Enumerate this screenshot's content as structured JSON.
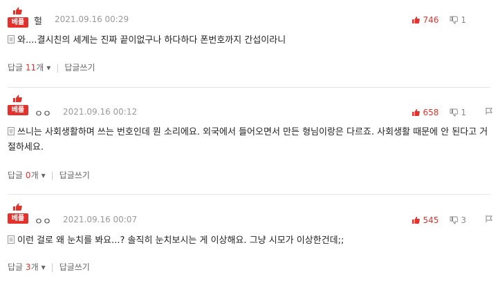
{
  "badge_label": "베플",
  "comments": [
    {
      "nickname": "헐",
      "date": "2021.09.16 00:29",
      "upvotes": "746",
      "downvotes": "1",
      "text": "와....결시친의 세계는 진짜 끝이없구나 하다하다 폰번호까지 간섭이라니",
      "reply_label": "답글",
      "reply_count": "11",
      "reply_suffix": "개",
      "write_reply": "답글쓰기"
    },
    {
      "nickname": "ㅇㅇ",
      "date": "2021.09.16 00:12",
      "upvotes": "658",
      "downvotes": "1",
      "text": "쓰니는 사회생활하며 쓰는 번호인데 뭔 소리에요. 외국에서 들어오면서 만든 형님이랑은 다르죠. 사회생활 때문에 안 된다고 거절하세요.",
      "reply_label": "답글",
      "reply_count": "0",
      "reply_suffix": "개",
      "write_reply": "답글쓰기"
    },
    {
      "nickname": "ㅇㅇ",
      "date": "2021.09.16 00:07",
      "upvotes": "545",
      "downvotes": "3",
      "text": "이런 걸로 왜 눈치를 봐요...? 솔직히 눈치보시는 게 이상해요. 그냥 시모가 이상한건데;;",
      "reply_label": "답글",
      "reply_count": "3",
      "reply_suffix": "개",
      "write_reply": "답글쓰기"
    }
  ],
  "colors": {
    "accent": "#e3322c",
    "muted": "#999999"
  }
}
